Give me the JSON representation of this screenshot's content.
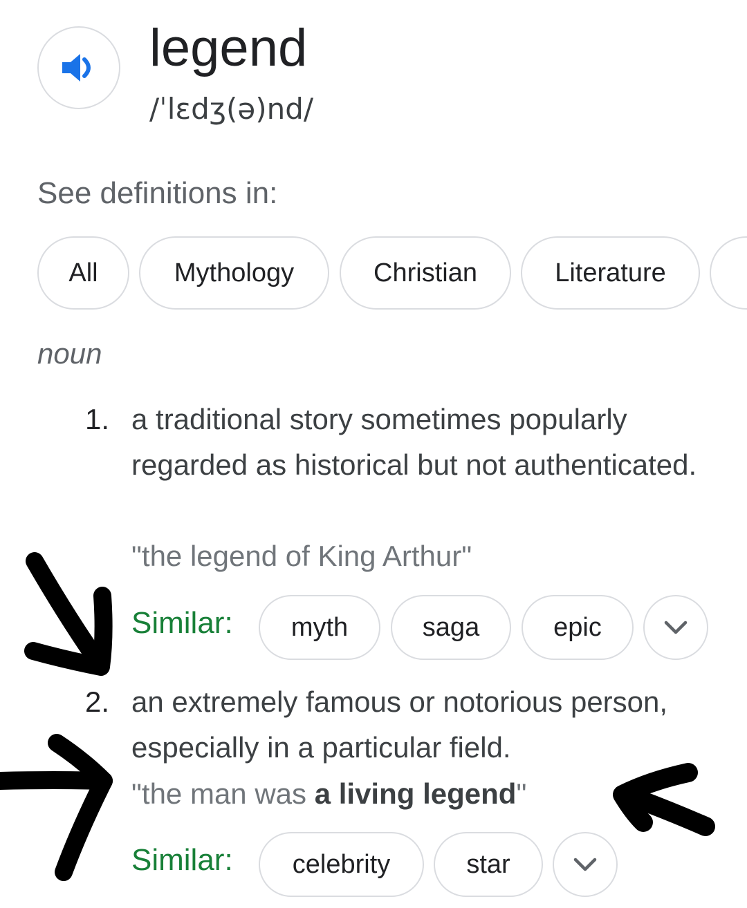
{
  "entry": {
    "word": "legend",
    "phonetic": "/ˈlɛdʒ(ə)nd/",
    "audio_icon": "speaker-icon"
  },
  "see_definitions_label": "See definitions in:",
  "categories": [
    "All",
    "Mythology",
    "Christian",
    "Literature"
  ],
  "part_of_speech": "noun",
  "senses": [
    {
      "number": "1.",
      "definition": "a traditional story sometimes popularly regarded as historical but not authenticated.",
      "example": "\"the legend of King Arthur\"",
      "similar_label": "Similar:",
      "synonyms": [
        "myth",
        "saga",
        "epic"
      ]
    },
    {
      "number": "2.",
      "definition": "an extremely famous or notorious person, especially in a particular field.",
      "example_prefix": "\"the man was ",
      "example_bold": "a living legend",
      "example_suffix": "\"",
      "similar_label": "Similar:",
      "synonyms": [
        "celebrity",
        "star"
      ]
    }
  ],
  "colors": {
    "text": "#202124",
    "secondary": "#5f6368",
    "example": "#70757a",
    "similar_green": "#188038",
    "speaker_blue": "#1a73e8",
    "chip_border": "#dadce0",
    "annotation_ink": "#000000"
  }
}
